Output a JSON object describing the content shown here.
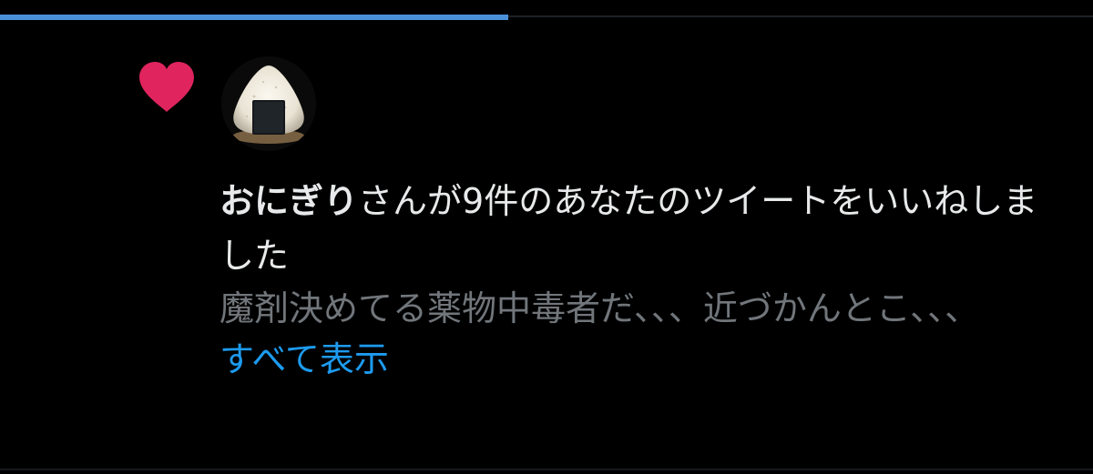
{
  "notification": {
    "type_icon": "heart-icon",
    "avatar_icon": "onigiri-avatar-icon",
    "user_name": "おにぎり",
    "action_text": "さんが9件のあなたのツイートをいいねしました",
    "tweet_text": "魔剤決めてる薬物中毒者だ、、、近づかんとこ、、、",
    "show_all_label": "すべて表示"
  },
  "progress": {
    "value": 0.465
  },
  "colors": {
    "background": "#000000",
    "heart": "#e0245e",
    "link": "#1d9bf0",
    "progress": "#4a90d9",
    "primary_text": "#e7e9ea",
    "secondary_text": "#71767b"
  }
}
